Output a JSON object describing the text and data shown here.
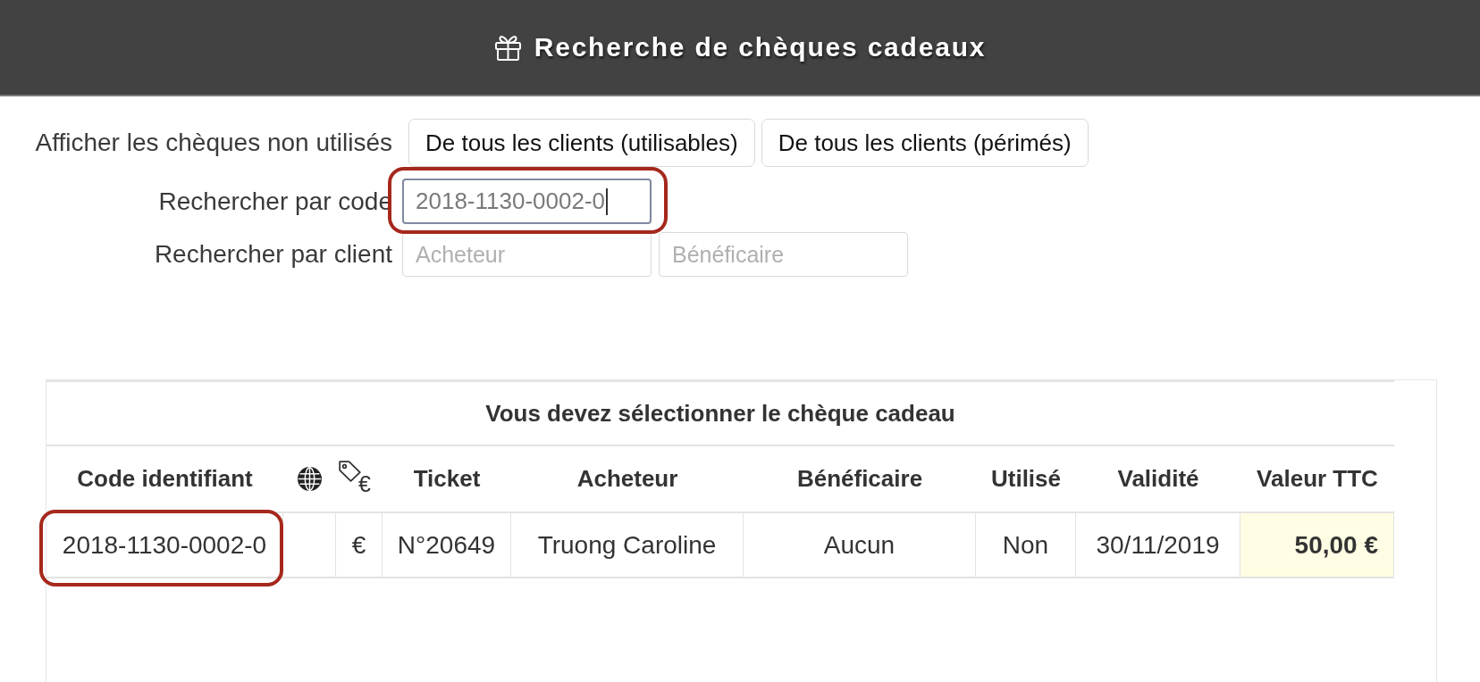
{
  "header": {
    "title": "Recherche de chèques cadeaux"
  },
  "filters": {
    "show_unused": {
      "label": "Afficher les chèques non utilisés",
      "buttons": [
        "De tous les clients (utilisables)",
        "De tous les clients (périmés)"
      ]
    },
    "code_search": {
      "label": "Rechercher par code",
      "value": "2018-1130-0002-0",
      "focused": true,
      "highlighted": true
    },
    "client_search": {
      "label": "Rechercher par client",
      "fields": [
        {
          "placeholder": "Acheteur"
        },
        {
          "placeholder": "Bénéficaire"
        }
      ]
    }
  },
  "results": {
    "title": "Vous devez sélectionner le chèque cadeau",
    "columns": [
      {
        "kind": "text",
        "label": "Code identifiant"
      },
      {
        "kind": "globe"
      },
      {
        "kind": "price-tag",
        "label": "€"
      },
      {
        "kind": "text",
        "label": "Ticket"
      },
      {
        "kind": "text",
        "label": "Acheteur"
      },
      {
        "kind": "text",
        "label": "Bénéficaire"
      },
      {
        "kind": "text",
        "label": "Utilisé"
      },
      {
        "kind": "text",
        "label": "Validité"
      },
      {
        "kind": "amount",
        "label": "Valeur TTC"
      }
    ],
    "rows": [
      {
        "cells": [
          {
            "text": "2018-1130-0002-0",
            "highlighted": true
          },
          {
            "highlighted": false
          },
          {
            "text": "€",
            "highlighted": false
          },
          {
            "text": "N°20649",
            "highlighted": false
          },
          {
            "text": "Truong Caroline",
            "highlighted": false
          },
          {
            "text": "Aucun",
            "highlighted": false
          },
          {
            "text": "Non",
            "highlighted": false
          },
          {
            "text": "30/11/2019",
            "highlighted": false
          },
          {
            "text": "50,00 €",
            "highlighted": false
          }
        ]
      }
    ]
  }
}
